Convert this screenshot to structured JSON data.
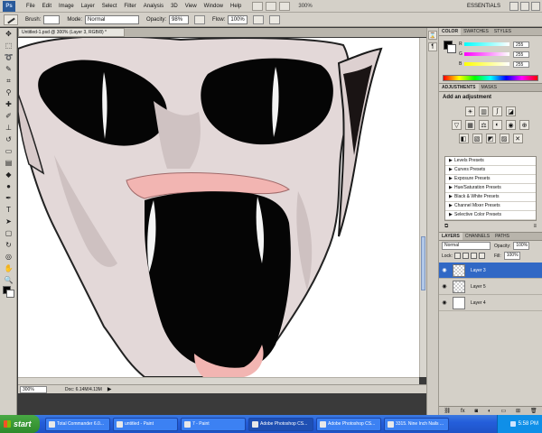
{
  "menubar": {
    "logo": "Ps",
    "items": [
      "File",
      "Edit",
      "Image",
      "Layer",
      "Select",
      "Filter",
      "Analysis",
      "3D",
      "View",
      "Window",
      "Help"
    ],
    "zoom": "300%",
    "workspace": "ESSENTIALS"
  },
  "options": {
    "brush_label": "Brush:",
    "mode_label": "Mode:",
    "mode_value": "Normal",
    "opacity_label": "Opacity:",
    "opacity_value": "98%",
    "flow_label": "Flow:",
    "flow_value": "100%"
  },
  "document": {
    "tab_title": "Untitled-1.psd @ 300% (Layer 3, RGB/8) *"
  },
  "status": {
    "zoom": "300%",
    "doc_info": "Doc: 6.14M/4.13M",
    "arrow": "▶"
  },
  "color_panel": {
    "tabs": [
      "COLOR",
      "SWATCHES",
      "STYLES"
    ],
    "r": {
      "label": "R",
      "value": "255"
    },
    "g": {
      "label": "G",
      "value": "255"
    },
    "b": {
      "label": "B",
      "value": "255"
    }
  },
  "adjustments_panel": {
    "tabs": [
      "ADJUSTMENTS",
      "MASKS"
    ],
    "title": "Add an adjustment",
    "presets": [
      "Levels Presets",
      "Curves Presets",
      "Exposure Presets",
      "Hue/Saturation Presets",
      "Black & White Presets",
      "Channel Mixer Presets",
      "Selective Color Presets"
    ]
  },
  "layers_panel": {
    "tabs": [
      "LAYERS",
      "CHANNELS",
      "PATHS"
    ],
    "blend_mode": "Normal",
    "opacity_label": "Opacity:",
    "opacity_value": "100%",
    "lock_label": "Lock:",
    "fill_label": "Fill:",
    "fill_value": "100%",
    "layers": [
      {
        "name": "Layer 3"
      },
      {
        "name": "Layer 5"
      },
      {
        "name": "Layer 4"
      }
    ]
  },
  "taskbar": {
    "start_label": "start",
    "tasks": [
      "Total Commander 6.0...",
      "untitled - Paint",
      "7 - Paint",
      "Adobe Photoshop CS...",
      "Adobe Photoshop CS...",
      "3315. Nine Inch Nails ..."
    ],
    "clock": "5:58 PM"
  },
  "colors": {
    "skin": "#e3d8d8",
    "gums": "#f2b5b2",
    "ink": "#050505",
    "highlight": "#3168c5"
  }
}
